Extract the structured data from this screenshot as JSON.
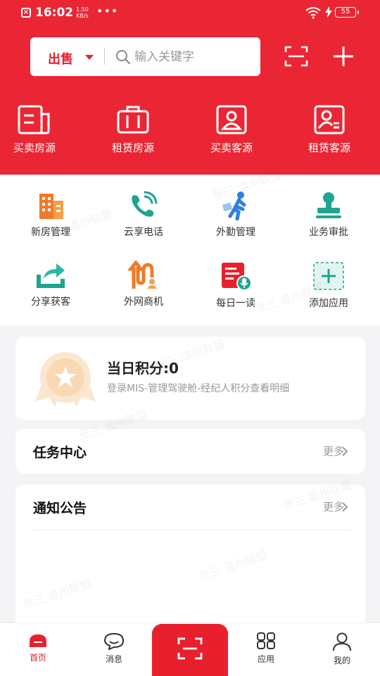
{
  "status_bar": {
    "time": "16:02",
    "speed_value": "1.50",
    "speed_unit": "KB/s",
    "dots": "•••",
    "battery": "55"
  },
  "search": {
    "type_label": "出售",
    "placeholder": "输入关键字"
  },
  "top_categories": [
    {
      "label": "买卖房源",
      "icon": "document-icon"
    },
    {
      "label": "租赁房源",
      "icon": "briefcase-icon"
    },
    {
      "label": "买卖客源",
      "icon": "person-card-icon"
    },
    {
      "label": "租赁客源",
      "icon": "person-card-lines-icon"
    }
  ],
  "functions": [
    {
      "label": "新房管理",
      "icon": "building-icon"
    },
    {
      "label": "云享电话",
      "icon": "phone-icon"
    },
    {
      "label": "外勤管理",
      "icon": "walking-person-icon"
    },
    {
      "label": "业务审批",
      "icon": "stamp-icon"
    },
    {
      "label": "分享获客",
      "icon": "share-icon"
    },
    {
      "label": "外网商机",
      "icon": "network-opportunity-icon"
    },
    {
      "label": "每日一读",
      "icon": "daily-read-icon"
    },
    {
      "label": "添加应用",
      "icon": "add-app-icon"
    }
  ],
  "points": {
    "title": "当日积分:0",
    "desc": "登录MIS-管理驾驶舱-经纪人积分查看明细"
  },
  "task": {
    "title": "任务中心",
    "more": "更多"
  },
  "notice": {
    "title": "通知公告",
    "more": "更多"
  },
  "tabs": [
    {
      "label": "首页",
      "icon": "home-icon"
    },
    {
      "label": "消息",
      "icon": "message-icon"
    },
    {
      "label": "应用",
      "icon": "apps-icon"
    },
    {
      "label": "我的",
      "icon": "profile-icon"
    }
  ],
  "watermark": "张三 温州联盟",
  "colors": {
    "brand_red": "#eb2634",
    "background": "#f4f4f6"
  }
}
